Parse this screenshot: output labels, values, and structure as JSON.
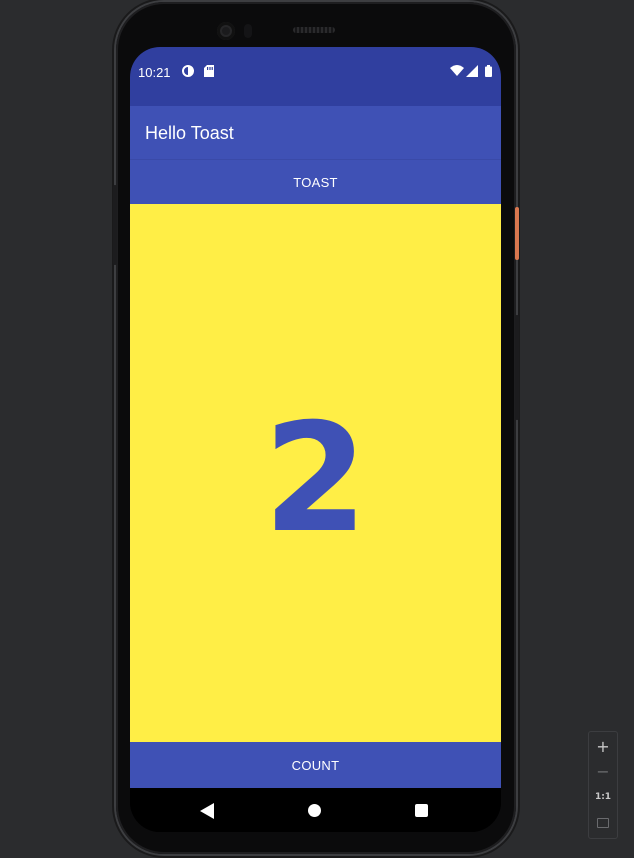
{
  "status_bar": {
    "time": "10:21",
    "left_icons": [
      "data-saver-icon",
      "sd-card-icon"
    ],
    "right_icons": [
      "wifi-icon",
      "signal-icon",
      "battery-icon"
    ]
  },
  "app_bar": {
    "title": "Hello Toast"
  },
  "buttons": {
    "toast_label": "TOAST",
    "count_label": "COUNT"
  },
  "counter": {
    "value": "2"
  },
  "nav_bar": {
    "icons": [
      "back-icon",
      "home-icon",
      "recents-icon"
    ]
  },
  "zoom_controls": {
    "zoom_in": "+",
    "zoom_out": "−",
    "actual_size": "1:1"
  },
  "colors": {
    "primary": "#3f51b5",
    "primary_dark": "#303f9f",
    "count_background": "#ffee46",
    "emulator_background": "#2b2c2e"
  }
}
